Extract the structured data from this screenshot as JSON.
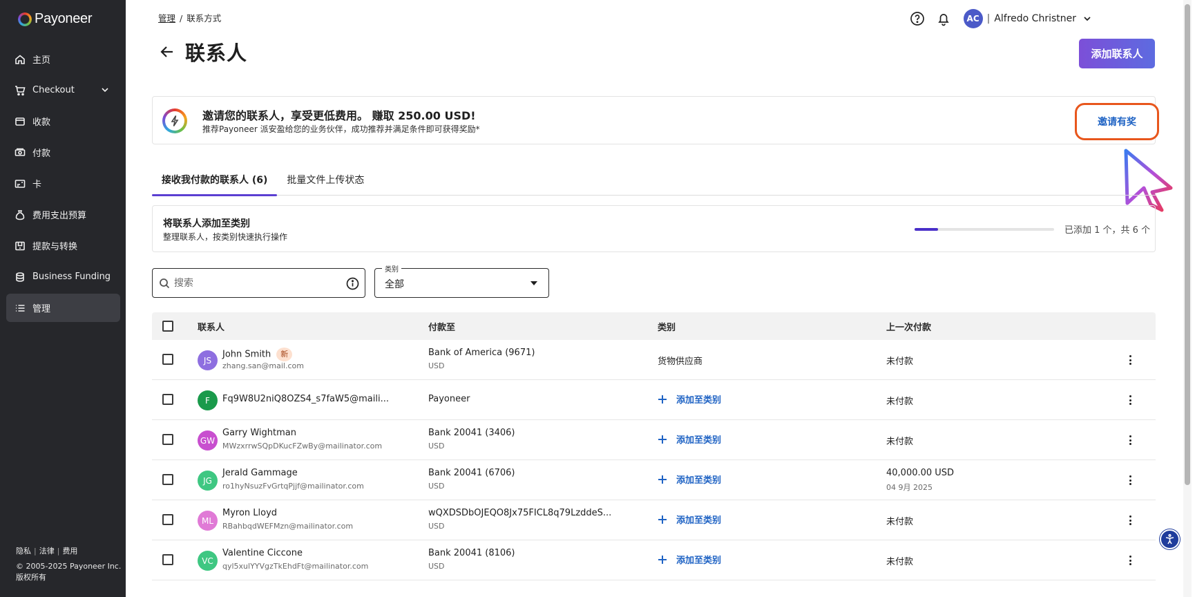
{
  "app": {
    "logo_text": "Payoneer"
  },
  "sidebar": {
    "items": [
      {
        "label": "主页",
        "icon": "home-icon"
      },
      {
        "label": "Checkout",
        "icon": "cart-icon"
      },
      {
        "label": "收款",
        "icon": "wallet-icon"
      },
      {
        "label": "付款",
        "icon": "payment-icon"
      },
      {
        "label": "卡",
        "icon": "card-icon"
      },
      {
        "label": "费用支出预算",
        "icon": "budget-icon"
      },
      {
        "label": "提款与转换",
        "icon": "withdraw-icon"
      },
      {
        "label": "Business Funding",
        "icon": "funding-icon"
      },
      {
        "label": "管理",
        "icon": "list-icon"
      }
    ],
    "active_item": "管理",
    "footer": {
      "links": [
        "隐私",
        "法律",
        "费用"
      ],
      "copyright": "© 2005-2025 Payoneer Inc.",
      "rights": "版权所有"
    }
  },
  "breadcrumb": {
    "parent": "管理",
    "separator": "/",
    "current": "联系方式"
  },
  "page": {
    "title": "联系人",
    "add_button": "添加联系人"
  },
  "header": {
    "avatar_initials": "AC",
    "separator": "|",
    "user_name": "Alfredo Christner"
  },
  "promo": {
    "title": "邀请您的联系人，享受更低费用。 赚取 250.00 USD!",
    "subtitle": "推荐Payoneer 派安盈给您的业务伙伴，成功推荐并满足条件即可获得奖励*",
    "button": "邀请有奖"
  },
  "tabs": [
    {
      "label": "接收我付款的联系人 (6)",
      "active": true
    },
    {
      "label": "批量文件上传状态",
      "active": false
    }
  ],
  "category_prompt": {
    "title": "将联系人添加至类别",
    "subtitle": "整理联系人，按类别快速执行操作",
    "progress_fraction": 0.167,
    "progress_text": "已添加 1 个，共 6 个"
  },
  "search": {
    "placeholder": "搜索",
    "value": ""
  },
  "category_filter": {
    "label": "类别",
    "value": "全部"
  },
  "table": {
    "columns": [
      "联系人",
      "付款至",
      "类别",
      "上一次付款"
    ],
    "add_category_label": "添加至类别",
    "rows": [
      {
        "initials": "JS",
        "color": "#8e6fe0",
        "name": "John Smith",
        "badge": "新",
        "email": "zhang.san@mail.com",
        "pay_to": "Bank of America (9671)",
        "currency": "USD",
        "category": "货物供应商",
        "last_payment": "未付款",
        "last_date": ""
      },
      {
        "initials": "F",
        "color": "#1a9a4b",
        "name": "Fq9W8U2niQ8OZS4_s7faW5@maili...",
        "badge": "",
        "email": "",
        "pay_to": "Payoneer",
        "currency": "",
        "category": "",
        "last_payment": "未付款",
        "last_date": ""
      },
      {
        "initials": "GW",
        "color": "#c84fcf",
        "name": "Garry Wightman",
        "badge": "",
        "email": "MWzxrrwSQpDKucFZwBy@mailinator.com",
        "pay_to": "Bank 20041 (3406)",
        "currency": "USD",
        "category": "",
        "last_payment": "未付款",
        "last_date": ""
      },
      {
        "initials": "JG",
        "color": "#3fc782",
        "name": "Jerald Gammage",
        "badge": "",
        "email": "ro1hyNsuzFvGrtqPjjf@mailinator.com",
        "pay_to": "Bank 20041 (6706)",
        "currency": "USD",
        "category": "",
        "last_payment": "40,000.00 USD",
        "last_date": "04 9月 2025"
      },
      {
        "initials": "ML",
        "color": "#e07ad6",
        "name": "Myron Lloyd",
        "badge": "",
        "email": "RBahbqdWEFMzn@mailinator.com",
        "pay_to": "wQXDSDbOJEQO8Jx75FICL8q79LzddeS...",
        "currency": "USD",
        "category": "",
        "last_payment": "未付款",
        "last_date": ""
      },
      {
        "initials": "VC",
        "color": "#3fc782",
        "name": "Valentine Ciccone",
        "badge": "",
        "email": "qyl5xulYYVgzTkEhdFt@mailinator.com",
        "pay_to": "Bank 20041 (8106)",
        "currency": "USD",
        "category": "",
        "last_payment": "未付款",
        "last_date": ""
      }
    ]
  },
  "colors": {
    "sidebar_bg": "#26272b",
    "accent_purple": "#5b3fd2",
    "link_blue": "#1f63c4",
    "highlight_orange": "#e8561c"
  }
}
